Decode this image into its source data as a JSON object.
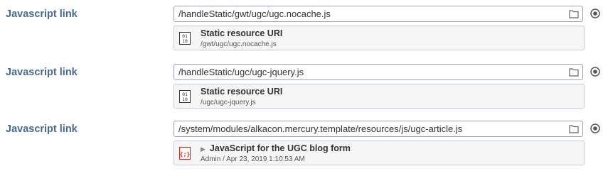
{
  "fields": [
    {
      "label": "Javascript link",
      "value": "/handleStatic/gwt/ugc/ugc.nocache.js",
      "resource": {
        "icon": "binary-file-icon",
        "title": "Static resource URI",
        "subtitle": "/gwt/ugc/ugc.nocache.js"
      }
    },
    {
      "label": "Javascript link",
      "value": "/handleStatic/ugc/ugc-jquery.js",
      "resource": {
        "icon": "binary-file-icon",
        "title": "Static resource URI",
        "subtitle": "/ugc/ugc-jquery.js"
      }
    },
    {
      "label": "Javascript link",
      "value": "/system/modules/alkacon.mercury.template/resources/js/ugc-article.js",
      "resource": {
        "icon": "javascript-file-icon",
        "title": "JavaScript for the UGC blog form",
        "subtitle": "Admin / Apr 23, 2019 1:10:53 AM",
        "has_caret": true
      }
    }
  ],
  "colors": {
    "label": "#4a6b8f",
    "js_icon": "#d9281a"
  }
}
